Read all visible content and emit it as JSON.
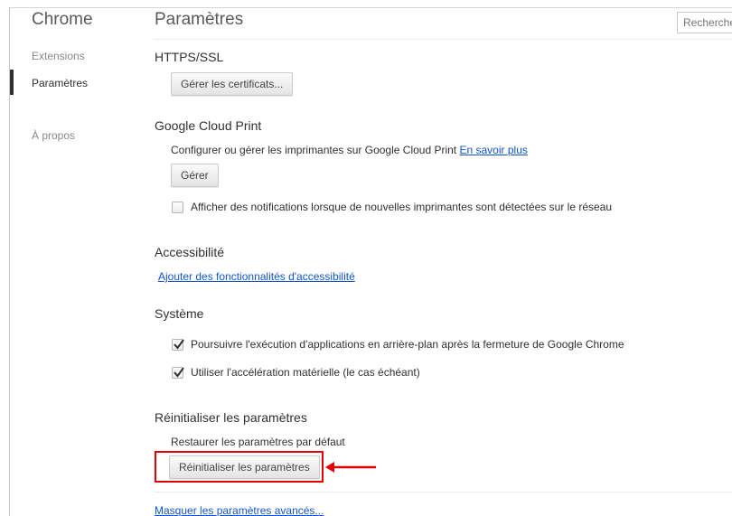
{
  "sidebar": {
    "app_title": "Chrome",
    "items": [
      {
        "label": "Extensions"
      },
      {
        "label": "Paramètres"
      },
      {
        "label": "À propos"
      }
    ]
  },
  "header": {
    "title": "Paramètres",
    "search_placeholder": "Rechercher"
  },
  "sections": {
    "https": {
      "title": "HTTPS/SSL",
      "button_label": "Gérer les certificats..."
    },
    "cloud_print": {
      "title": "Google Cloud Print",
      "description": "Configurer ou gérer les imprimantes sur Google Cloud Print",
      "link": "En savoir plus",
      "button_label": "Gérer",
      "checkbox_label": "Afficher des notifications lorsque de nouvelles imprimantes sont détectées sur le réseau",
      "checkbox_checked": false
    },
    "accessibility": {
      "title": "Accessibilité",
      "link": "Ajouter des fonctionnalités d'accessibilité"
    },
    "system": {
      "title": "Système",
      "options": [
        {
          "label": "Poursuivre l'exécution d'applications en arrière-plan après la fermeture de Google Chrome",
          "checked": true
        },
        {
          "label": "Utiliser l'accélération matérielle (le cas échéant)",
          "checked": true
        }
      ]
    },
    "reset": {
      "title": "Réinitialiser les paramètres",
      "description": "Restaurer les paramètres par défaut",
      "button_label": "Réinitialiser les paramètres"
    }
  },
  "footer": {
    "hide_advanced_link": "Masquer les paramètres avancés..."
  },
  "colors": {
    "link": "#1155cc",
    "highlight": "#e00000",
    "text": "#303030"
  }
}
